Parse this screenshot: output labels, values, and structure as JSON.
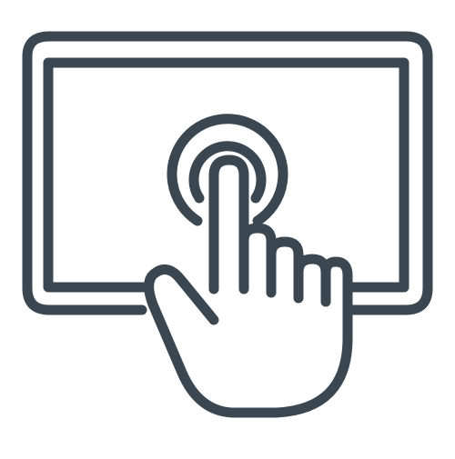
{
  "icon": {
    "semantic": "tablet-touch-icon",
    "stroke_color": "#3b4750",
    "background": "#ffffff",
    "parts": [
      "tablet-outer-frame",
      "tablet-screen",
      "touch-ripple",
      "pointing-hand"
    ]
  }
}
